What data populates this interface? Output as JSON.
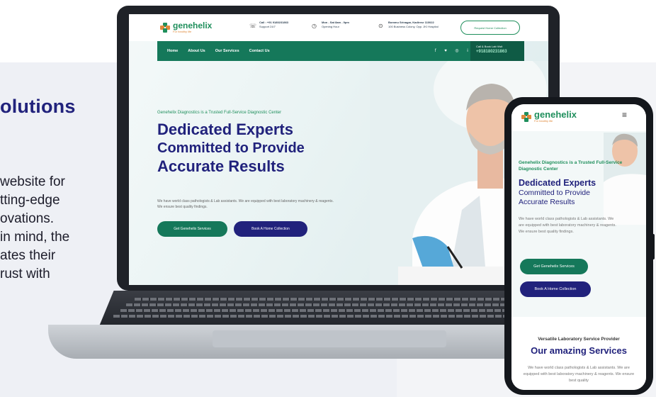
{
  "showcase": {
    "heading": "olutions",
    "paragraph_lines": [
      "website for",
      "tting-edge",
      "ovations.",
      "in mind, the",
      "ates their",
      "rust with"
    ]
  },
  "site": {
    "brand": "genehelix",
    "brand_sub": "diagnostics",
    "tagline": "For healthy life",
    "header": {
      "call_label": "Call : +91 9180231863",
      "call_sub": "Support 24/7",
      "hours_label": "Mon - Sat 8am - 9pm",
      "hours_sub": "Opening Hour",
      "address_label": "Bommu Srinagar, Kadiresr 110022",
      "address_sub": "100 Business Colony, Opp. JKI Hospital",
      "request_button": "Request Home Collection"
    },
    "nav": {
      "items": [
        "Home",
        "About Us",
        "Our Services",
        "Contact Us"
      ],
      "social": "f  ♥  ◎  in",
      "call_box_label": "Call & Book Lab Visit",
      "call_box_number": "+918180231863"
    },
    "hero": {
      "tag": "Genehelix Diagnostics is a Trusted Full-Service Diagnostic Center",
      "title_1": "Dedicated Experts",
      "title_2": "Committed to Provide",
      "title_3": "Accurate Results",
      "lead": "We have world class pathologists & Lab assistants. We are equipped with best laboratory machinery & reagents. We ensure best quality findings.",
      "primary_button": "Get Genehelix Services",
      "secondary_button": "Book A Home Collection"
    },
    "mobile": {
      "tag": "Genehelix Diagnostics is a Trusted Full-Service Diagnostic Center",
      "title_1": "Dedicated Experts",
      "title_2": "Committed to Provide",
      "title_3": "Accurate Results",
      "lead": "We have world class pathologists & Lab assistants. We are equipped with best laboratory machinery & reagents. We ensure best quality findings.",
      "primary_button": "Get Genehelix Services",
      "secondary_button": "Book A Home Collection",
      "services_sub": "Versatile Laboratory Service Provider",
      "services_title": "Our amazing Services",
      "services_text": "We have world class pathologists & Lab assistants. We are equipped with best laboratory machinery & reagents. We ensure best quality"
    }
  },
  "colors": {
    "brand_green": "#15785a",
    "brand_navy": "#21227c",
    "brand_orange": "#e08a3c"
  }
}
